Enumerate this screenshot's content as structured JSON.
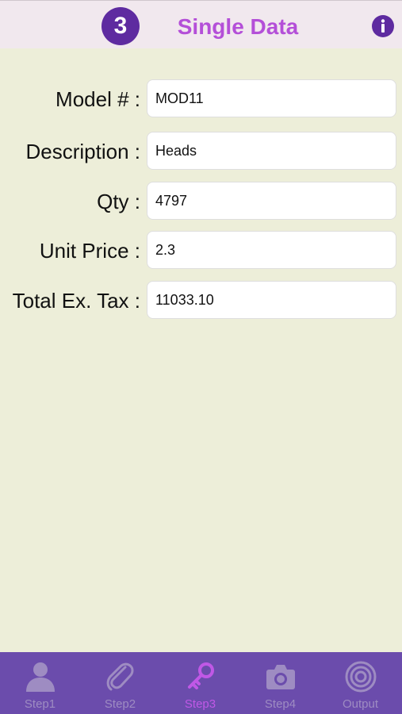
{
  "header": {
    "step_number": "3",
    "title": "Single Data",
    "info_icon": "info-icon"
  },
  "form": {
    "fields": [
      {
        "label": "Model # :",
        "value": "MOD11"
      },
      {
        "label": "Description :",
        "value": "Heads"
      },
      {
        "label": "Qty :",
        "value": "4797"
      },
      {
        "label": "Unit Price :",
        "value": "2.3"
      },
      {
        "label": "Total Ex. Tax :",
        "value": "11033.10"
      }
    ]
  },
  "tabbar": {
    "active_index": 2,
    "tabs": [
      {
        "label": "Step1",
        "icon": "person-icon"
      },
      {
        "label": "Step2",
        "icon": "paperclip-icon"
      },
      {
        "label": "Step3",
        "icon": "key-icon"
      },
      {
        "label": "Step4",
        "icon": "camera-icon"
      },
      {
        "label": "Output",
        "icon": "target-icon"
      }
    ]
  },
  "colors": {
    "background": "#EDEED9",
    "header_background": "#F1E8EE",
    "accent_purple": "#5E2BA0",
    "title_color": "#B44FD8",
    "tabbar_background": "#6B4CAC",
    "tab_inactive": "#9E8CC2",
    "tab_active": "#C058E6"
  }
}
